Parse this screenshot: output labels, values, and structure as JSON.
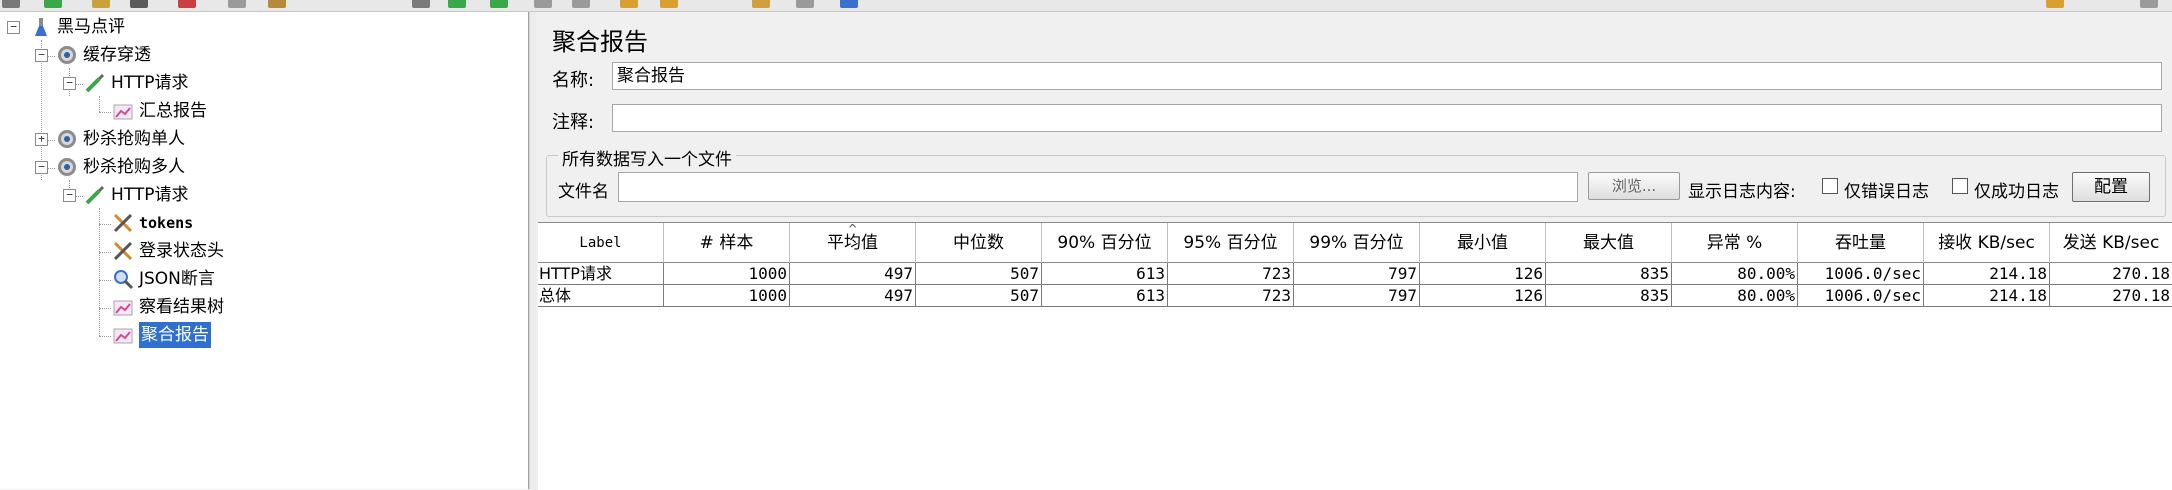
{
  "tree": {
    "root": "黑马点评",
    "cache_group": "缓存穿透",
    "http_request_1": "HTTP请求",
    "summary_report": "汇总报告",
    "seckill_single": "秒杀抢购单人",
    "seckill_multi": "秒杀抢购多人",
    "http_request_2": "HTTP请求",
    "tokens": "tokens",
    "login_header": "登录状态头",
    "json_assert": "JSON断言",
    "view_results_tree": "察看结果树",
    "aggregate_report": "聚合报告"
  },
  "panel": {
    "title": "聚合报告",
    "name_label": "名称:",
    "name_value": "聚合报告",
    "comment_label": "注释:",
    "comment_value": "",
    "file_group_title": "所有数据写入一个文件",
    "filename_label": "文件名",
    "filename_value": "",
    "browse_button": "浏览...",
    "log_content_label": "显示日志内容:",
    "errors_only_label": "仅错误日志",
    "success_only_label": "仅成功日志",
    "configure_button": "配置"
  },
  "table": {
    "headers": [
      "Label",
      "# 样本",
      "平均值",
      "中位数",
      "90% 百分位",
      "95% 百分位",
      "99% 百分位",
      "最小值",
      "最大值",
      "异常 %",
      "吞吐量",
      "接收 KB/sec",
      "发送 KB/sec"
    ],
    "rows": [
      [
        "HTTP请求",
        "1000",
        "497",
        "507",
        "613",
        "723",
        "797",
        "126",
        "835",
        "80.00%",
        "1006.0/sec",
        "214.18",
        "270.18"
      ],
      [
        "总体",
        "1000",
        "497",
        "507",
        "613",
        "723",
        "797",
        "126",
        "835",
        "80.00%",
        "1006.0/sec",
        "214.18",
        "270.18"
      ]
    ]
  },
  "colors": {
    "selection": "#2f6fd0",
    "panel_bg": "#f0f0f0"
  }
}
